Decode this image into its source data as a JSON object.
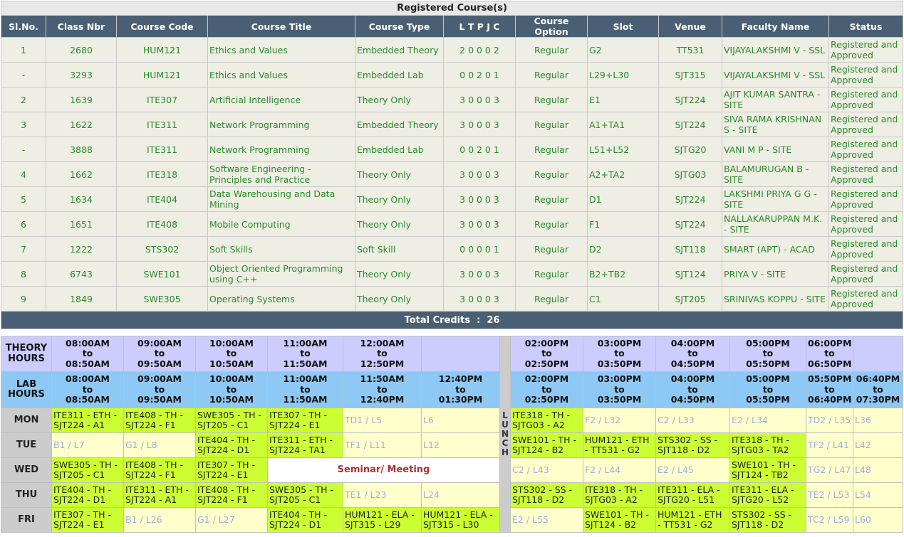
{
  "registered": {
    "title": "Registered Course(s)",
    "headers": [
      "Sl.No.",
      "Class Nbr",
      "Course Code",
      "Course Title",
      "Course Type",
      "L T P J C",
      "Course Option",
      "Slot",
      "Venue",
      "Faculty Name",
      "Status"
    ],
    "rows": [
      {
        "sl": "1",
        "nbr": "2680",
        "code": "HUM121",
        "title": "Ethics and Values",
        "type": "Embedded Theory",
        "ltpjc": "2 0 0 0 2",
        "option": "Regular",
        "slot": "G2",
        "venue": "TT531",
        "faculty": "VIJAYALAKSHMI V - SSL",
        "status": "Registered and Approved"
      },
      {
        "sl": "-",
        "nbr": "3293",
        "code": "HUM121",
        "title": "Ethics and Values",
        "type": "Embedded Lab",
        "ltpjc": "0 0 2 0 1",
        "option": "Regular",
        "slot": "L29+L30",
        "venue": "SJT315",
        "faculty": "VIJAYALAKSHMI V - SSL",
        "status": "Registered and Approved"
      },
      {
        "sl": "2",
        "nbr": "1639",
        "code": "ITE307",
        "title": "Artificial Intelligence",
        "type": "Theory Only",
        "ltpjc": "3 0 0 0 3",
        "option": "Regular",
        "slot": "E1",
        "venue": "SJT224",
        "faculty": "AJIT KUMAR SANTRA - SITE",
        "status": "Registered and Approved"
      },
      {
        "sl": "3",
        "nbr": "1622",
        "code": "ITE311",
        "title": "Network Programming",
        "type": "Embedded Theory",
        "ltpjc": "3 0 0 0 3",
        "option": "Regular",
        "slot": "A1+TA1",
        "venue": "SJT224",
        "faculty": "SIVA RAMA KRISHNAN S - SITE",
        "status": "Registered and Approved"
      },
      {
        "sl": "-",
        "nbr": "3888",
        "code": "ITE311",
        "title": "Network Programming",
        "type": "Embedded Lab",
        "ltpjc": "0 0 2 0 1",
        "option": "Regular",
        "slot": "L51+L52",
        "venue": "SJTG20",
        "faculty": "VANI M P - SITE",
        "status": "Registered and Approved"
      },
      {
        "sl": "4",
        "nbr": "1662",
        "code": "ITE318",
        "title": "Software Engineering - Principles and Practice",
        "type": "Theory Only",
        "ltpjc": "3 0 0 0 3",
        "option": "Regular",
        "slot": "A2+TA2",
        "venue": "SJTG03",
        "faculty": "BALAMURUGAN B - SITE",
        "status": "Registered and Approved"
      },
      {
        "sl": "5",
        "nbr": "1634",
        "code": "ITE404",
        "title": "Data Warehousing and Data Mining",
        "type": "Theory Only",
        "ltpjc": "3 0 0 0 3",
        "option": "Regular",
        "slot": "D1",
        "venue": "SJT224",
        "faculty": "LAKSHMI PRIYA G G - SITE",
        "status": "Registered and Approved"
      },
      {
        "sl": "6",
        "nbr": "1651",
        "code": "ITE408",
        "title": "Mobile Computing",
        "type": "Theory Only",
        "ltpjc": "3 0 0 0 3",
        "option": "Regular",
        "slot": "F1",
        "venue": "SJT224",
        "faculty": "NALLAKARUPPAN M.K. - SITE",
        "status": "Registered and Approved"
      },
      {
        "sl": "7",
        "nbr": "1222",
        "code": "STS302",
        "title": "Soft Skills",
        "type": "Soft Skill",
        "ltpjc": "0 0 0 0 1",
        "option": "Regular",
        "slot": "D2",
        "venue": "SJT118",
        "faculty": "SMART (APT) - ACAD",
        "status": "Registered and Approved"
      },
      {
        "sl": "8",
        "nbr": "6743",
        "code": "SWE101",
        "title": "Object Oriented Programming using C++",
        "type": "Theory Only",
        "ltpjc": "3 0 0 0 3",
        "option": "Regular",
        "slot": "B2+TB2",
        "venue": "SJT124",
        "faculty": "PRIYA V - SITE",
        "status": "Registered and Approved"
      },
      {
        "sl": "9",
        "nbr": "1849",
        "code": "SWE305",
        "title": "Operating Systems",
        "type": "Theory Only",
        "ltpjc": "3 0 0 0 3",
        "option": "Regular",
        "slot": "C1",
        "venue": "SJT205",
        "faculty": "SRINIVAS KOPPU - SITE",
        "status": "Registered and Approved"
      }
    ],
    "total_label": "Total Credits",
    "total_sep": ":",
    "total_value": "26"
  },
  "timetable": {
    "theory_label": "THEORY HOURS",
    "lab_label": "LAB HOURS",
    "lunch_letters": [
      "L",
      "U",
      "N",
      "C",
      "H"
    ],
    "theory_am": [
      "08:00AM to 08:50AM",
      "09:00AM to 09:50AM",
      "10:00AM to 10:50AM",
      "11:00AM to 11:50AM",
      "12:00AM to 12:50PM",
      ""
    ],
    "theory_pm": [
      "02:00PM to 02:50PM",
      "03:00PM to 03:50PM",
      "04:00PM to 04:50PM",
      "05:00PM to 05:50PM",
      "06:00PM to 06:50PM",
      ""
    ],
    "lab_am": [
      "08:00AM to 08:50AM",
      "09:00AM to 09:50AM",
      "10:00AM to 10:50AM",
      "11:00AM to 11:50AM",
      "11:50AM to 12:40PM",
      "12:40PM to 01:30PM"
    ],
    "lab_pm": [
      "02:00PM to 02:50PM",
      "03:00PM to 03:50PM",
      "04:00PM to 04:50PM",
      "05:00PM to 05:50PM",
      "05:50PM to 06:40PM",
      "06:40PM to 07:30PM"
    ],
    "seminar_label": "Seminar/ Meeting",
    "days": [
      {
        "day": "MON",
        "am": [
          {
            "t": "ITE311 - ETH - SJT224 - A1",
            "b": true
          },
          {
            "t": "ITE408 - TH - SJT224 - F1",
            "b": true
          },
          {
            "t": "SWE305 - TH - SJT205 - C1",
            "b": true
          },
          {
            "t": "ITE307 - TH - SJT224 - E1",
            "b": true
          },
          {
            "t": "TD1 / L5",
            "b": false
          },
          {
            "t": "L6",
            "b": false
          }
        ],
        "pm": [
          {
            "t": "ITE318 - TH - SJTG03 - A2",
            "b": true
          },
          {
            "t": "F2 / L32",
            "b": false
          },
          {
            "t": "C2 / L33",
            "b": false
          },
          {
            "t": "E2 / L34",
            "b": false
          },
          {
            "t": "TD2 / L35",
            "b": false
          },
          {
            "t": "L36",
            "b": false
          }
        ]
      },
      {
        "day": "TUE",
        "am": [
          {
            "t": "B1 / L7",
            "b": false
          },
          {
            "t": "G1 / L8",
            "b": false
          },
          {
            "t": "ITE404 - TH - SJT224 - D1",
            "b": true
          },
          {
            "t": "ITE311 - ETH - SJT224 - TA1",
            "b": true
          },
          {
            "t": "TF1 / L11",
            "b": false
          },
          {
            "t": "L12",
            "b": false
          }
        ],
        "pm": [
          {
            "t": "SWE101 - TH - SJT124 - B2",
            "b": true
          },
          {
            "t": "HUM121 - ETH - TT531 - G2",
            "b": true
          },
          {
            "t": "STS302 - SS - SJT118 - D2",
            "b": true
          },
          {
            "t": "ITE318 - TH - SJTG03 - TA2",
            "b": true
          },
          {
            "t": "TF2 / L41",
            "b": false
          },
          {
            "t": "L42",
            "b": false
          }
        ]
      },
      {
        "day": "WED",
        "am": [
          {
            "t": "SWE305 - TH - SJT205 - C1",
            "b": true
          },
          {
            "t": "ITE408 - TH - SJT224 - F1",
            "b": true
          },
          {
            "t": "ITE307 - TH - SJT224 - E1",
            "b": true
          }
        ],
        "pm": [
          {
            "t": "C2 / L43",
            "b": false
          },
          {
            "t": "F2 / L44",
            "b": false
          },
          {
            "t": "E2 / L45",
            "b": false
          },
          {
            "t": "SWE101 - TH - SJT124 - TB2",
            "b": true
          },
          {
            "t": "TG2 / L47",
            "b": false
          },
          {
            "t": "L48",
            "b": false
          }
        ]
      },
      {
        "day": "THU",
        "am": [
          {
            "t": "ITE404 - TH - SJT224 - D1",
            "b": true
          },
          {
            "t": "ITE311 - ETH - SJT224 - A1",
            "b": true
          },
          {
            "t": "ITE408 - TH - SJT224 - F1",
            "b": true
          },
          {
            "t": "SWE305 - TH - SJT205 - C1",
            "b": true
          },
          {
            "t": "TE1 / L23",
            "b": false
          },
          {
            "t": "L24",
            "b": false
          }
        ],
        "pm": [
          {
            "t": "STS302 - SS - SJT118 - D2",
            "b": true
          },
          {
            "t": "ITE318 - TH - SJTG03 - A2",
            "b": true
          },
          {
            "t": "ITE311 - ELA - SJTG20 - L51",
            "b": true
          },
          {
            "t": "ITE311 - ELA - SJTG20 - L52",
            "b": true
          },
          {
            "t": "TE2 / L53",
            "b": false
          },
          {
            "t": "L54",
            "b": false
          }
        ]
      },
      {
        "day": "FRI",
        "am": [
          {
            "t": "ITE307 - TH - SJT224 - E1",
            "b": true
          },
          {
            "t": "B1 / L26",
            "b": false
          },
          {
            "t": "G1 / L27",
            "b": false
          },
          {
            "t": "ITE404 - TH - SJT224 - D1",
            "b": true
          },
          {
            "t": "HUM121 - ELA - SJT315 - L29",
            "b": true
          },
          {
            "t": "HUM121 - ELA - SJT315 - L30",
            "b": true
          }
        ],
        "pm": [
          {
            "t": "E2 / L55",
            "b": false
          },
          {
            "t": "SWE101 - TH - SJT124 - B2",
            "b": true
          },
          {
            "t": "HUM121 - ETH - TT531 - G2",
            "b": true
          },
          {
            "t": "STS302 - SS - SJT118 - D2",
            "b": true
          },
          {
            "t": "TC2 / L59",
            "b": false
          },
          {
            "t": "L60",
            "b": false
          }
        ]
      }
    ]
  }
}
